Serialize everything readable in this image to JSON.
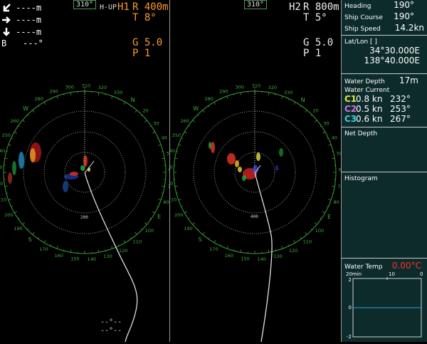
{
  "left_panel": {
    "heading_box": "310°",
    "mode": "H-UP",
    "channel": "H1",
    "range": "R 400m",
    "tilt": "T  8°",
    "gain": "G  5.0",
    "pulse": "P  1",
    "readouts": [
      {
        "icon": "arrow-down-left-icon",
        "value": "----m"
      },
      {
        "icon": "arrow-right-icon",
        "value": "----m"
      },
      {
        "icon": "arrow-down-icon",
        "value": "----m"
      }
    ],
    "bearing_label": "B",
    "bearing_value": "---°",
    "range_marker": "200",
    "bottom_values": [
      "--°--",
      "--°--"
    ],
    "rose_labels": [
      "300",
      "310",
      "320",
      "330",
      "N",
      "20",
      "30",
      "40",
      "50",
      "60",
      "70",
      "80",
      "E",
      "100",
      "110",
      "120",
      "130",
      "140",
      "150",
      "160",
      "170",
      "S",
      "190",
      "200",
      "210",
      "220",
      "230",
      "240",
      "250",
      "260",
      "W",
      "280",
      "290"
    ]
  },
  "right_panel": {
    "heading_box": "310°",
    "channel": "H2",
    "range": "R  800m",
    "tilt": "T   5°",
    "gain": "G   5.0",
    "pulse": "P   1",
    "range_marker": "400",
    "rose_labels": [
      "300",
      "310",
      "320",
      "330",
      "N",
      "20",
      "30",
      "40",
      "50",
      "60",
      "70",
      "80",
      "E",
      "100",
      "110",
      "120",
      "130",
      "140",
      "150",
      "160",
      "170",
      "S",
      "190",
      "200",
      "210",
      "220",
      "230",
      "240",
      "250",
      "260",
      "W",
      "280",
      "290"
    ]
  },
  "side_panel": {
    "heading_label": "Heading",
    "heading_value": "190°",
    "course_label": "Ship Course",
    "course_value": "190°",
    "speed_label": "Ship Speed",
    "speed_value": "14.2kn",
    "latlon_label": "Lat/Lon [ ]",
    "lat_value": "34°30.000E",
    "lon_value": "138°40.000E",
    "water_depth_label": "Water Depth",
    "water_depth_value": "17m",
    "water_current_label": "Water Current",
    "currents": [
      {
        "channel": "C1",
        "speed": "0.8 kn",
        "dir": "232°",
        "color": "#e8e83a"
      },
      {
        "channel": "C2",
        "speed": "0.5 kn",
        "dir": "253°",
        "color": "#d070e0"
      },
      {
        "channel": "C3",
        "speed": "0.6 kn",
        "dir": "267°",
        "color": "#3ad0e0"
      }
    ],
    "net_depth_label": "Net Depth",
    "histogram_label": "Histogram",
    "water_temp_label": "Water Temp",
    "water_temp_value": "0.00°C",
    "water_temp_color": "#ff3030",
    "graph_x_labels": [
      "20min",
      "10",
      "0"
    ],
    "graph_y_labels": [
      "2",
      "0",
      "-2"
    ]
  }
}
